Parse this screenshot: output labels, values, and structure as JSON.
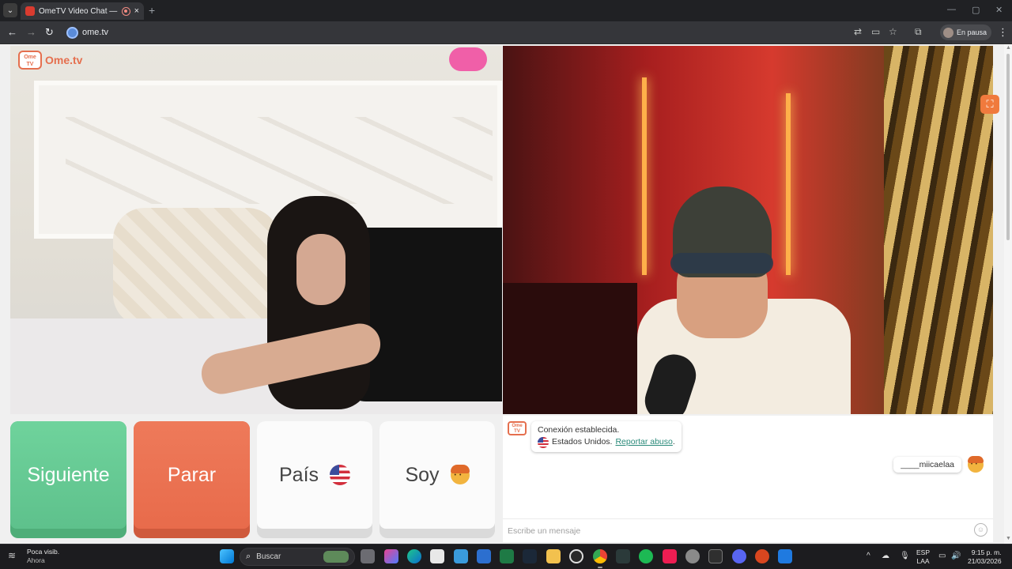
{
  "browser": {
    "tab_title": "OmeTV Video Chat — Omegle alternative",
    "url": "ome.tv",
    "profile_label": "En pausa",
    "menu_glyph": "⌄",
    "new_tab_glyph": "+",
    "close_glyph": "×",
    "minimize_glyph": "—",
    "maximize_glyph": "▢",
    "window_close_glyph": "✕",
    "back_glyph": "←",
    "forward_glyph": "→",
    "reload_glyph": "↻",
    "translate_glyph": "⇄",
    "cast_glyph": "▭",
    "star_glyph": "☆",
    "extensions_glyph": "⧉",
    "kebab_glyph": "⋮"
  },
  "site": {
    "logo_badge": "Ome TV",
    "logo_text": "Ome.tv",
    "snapshot_glyph": "⛶"
  },
  "controls": {
    "next_label": "Siguiente",
    "stop_label": "Parar",
    "country_label": "País",
    "gender_label": "Soy"
  },
  "chat": {
    "system_badge": "Ome TV",
    "connected_text": "Conexión establecida.",
    "country_text": "Estados Unidos.",
    "report_link": "Reportar abuso",
    "report_suffix": ".",
    "partner_name": "____miicaelaa",
    "input_placeholder": "Escribe un mensaje",
    "emoji_glyph": "☺"
  },
  "taskbar": {
    "weather_title": "Poca visib.",
    "weather_sub": "Ahora",
    "weather_glyph": "≋",
    "search_placeholder": "Buscar",
    "search_glyph": "⌕",
    "tray_chevron": "^",
    "lang_top": "ESP",
    "lang_bottom": "LAA",
    "time": "9:15 p. m.",
    "date": "21/03/2026",
    "mic_glyph": "🎙",
    "wifi_glyph": "◠",
    "volume_glyph": "🔊",
    "cloud_glyph": "☁",
    "battery_glyph": "▭"
  },
  "colors": {
    "next_green": "#5ec18c",
    "stop_orange": "#e86b4b",
    "brand_orange": "#e56f4e",
    "report_link": "#2a8a7a"
  }
}
